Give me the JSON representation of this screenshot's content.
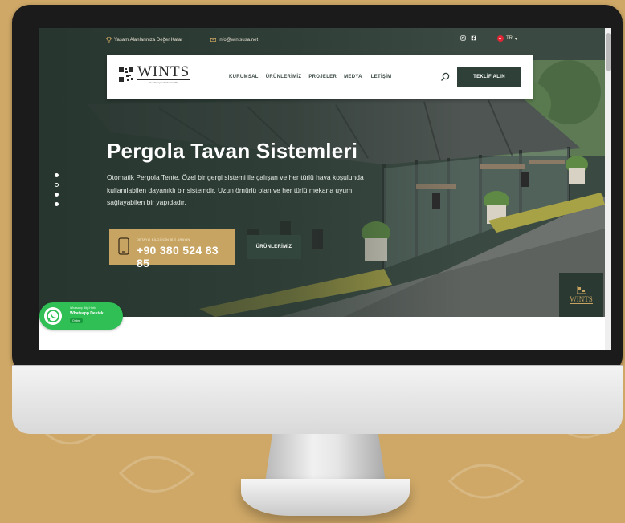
{
  "topbar": {
    "award_text": "Yaşam Alanlarınıza Değer Katar",
    "email": "info@wintsusa.net",
    "lang": "TR"
  },
  "nav": {
    "logo_name": "WINTS",
    "logo_tagline": "Her Detayda Mükemmellik",
    "menu": [
      "KURUMSAL",
      "ÜRÜNLERİMİZ",
      "PROJELER",
      "MEDYA",
      "İLETİŞİM"
    ],
    "quote_button": "TEKLİF ALIN"
  },
  "hero": {
    "title": "Pergola Tavan Sistemleri",
    "description": "Otomatik Pergola Tente, Özel bir gergi sistemi ile çalışan ve her türlü hava koşulunda kullanılabilen dayanıklı bir sistemdir. Uzun ömürlü olan ve her türlü mekana uyum sağlayabilen bir yapıdadır.",
    "phone_caption": "DETAYLI BİLGİ İÇİN BİZİ ARAYIN",
    "phone_number": "+90 380 524 83 85",
    "products_button": "ÜRÜNLERİMİZ",
    "corner_logo": "WINTS",
    "slides_total": 4,
    "active_slide": 2
  },
  "whatsapp": {
    "line1": "Whatsapp Bilgi Hattı",
    "line2": "Whatsapp Destek",
    "cta": "Online"
  },
  "colors": {
    "accent_gold": "#c8a462",
    "dark_green": "#2e4038",
    "whatsapp_green": "#2fbf55"
  }
}
